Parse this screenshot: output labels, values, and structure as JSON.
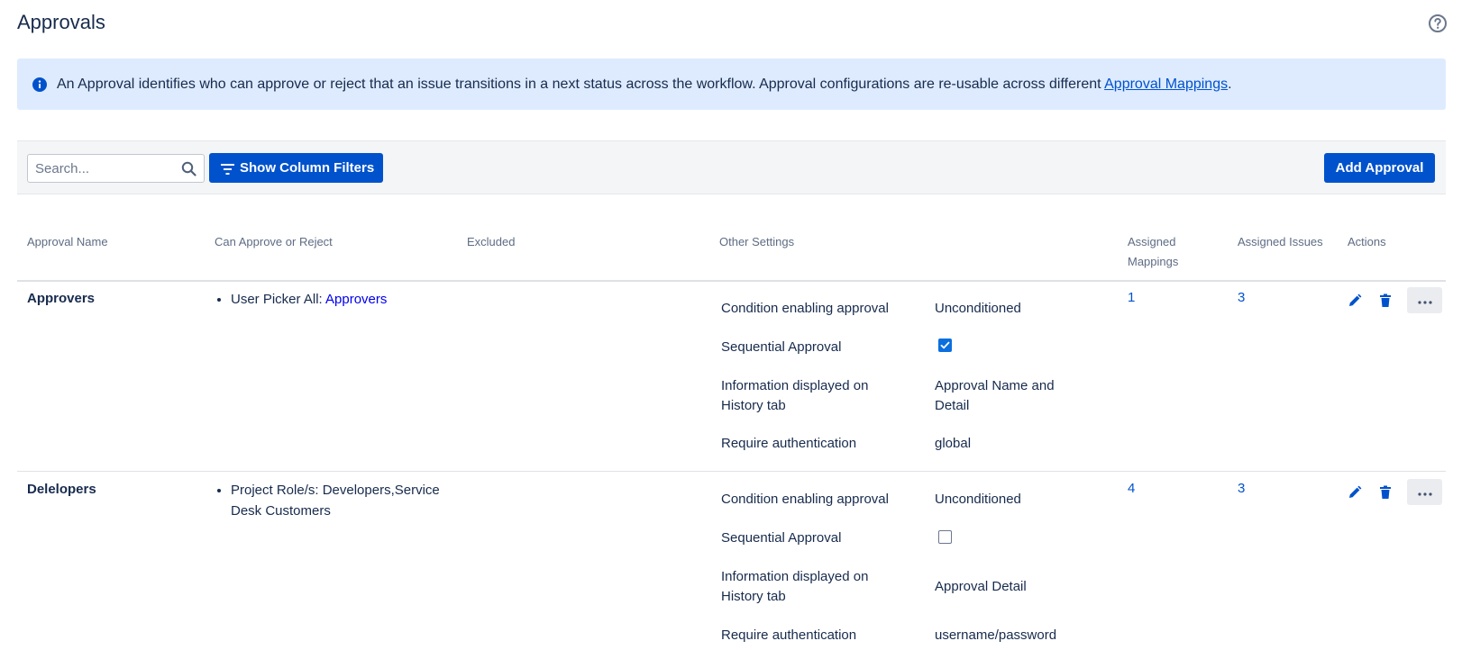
{
  "page": {
    "title": "Approvals"
  },
  "banner": {
    "text": "An Approval identifies who can approve or reject that an issue transitions in a next status across the workflow. Approval configurations are re-usable across different ",
    "link": "Approval Mappings",
    "suffix": "."
  },
  "toolbar": {
    "search_placeholder": "Search...",
    "filters_label": "Show Column Filters",
    "add_label": "Add Approval"
  },
  "columns": {
    "name": "Approval Name",
    "approve": "Can Approve or Reject",
    "excluded": "Excluded",
    "other": "Other Settings",
    "mappings_line1": "Assigned",
    "mappings_line2": "Mappings",
    "issues": "Assigned Issues",
    "actions": "Actions"
  },
  "rows": [
    {
      "name": "Approvers",
      "approver_prefix": "User Picker All: ",
      "approver_link": "Approvers",
      "settings": {
        "condition_label": "Condition enabling approval",
        "condition_value": "Unconditioned",
        "sequential_label": "Sequential Approval",
        "sequential_checked": true,
        "info_label_1": "Information displayed on",
        "info_label_2": "History tab",
        "info_value_1": "Approval Name and",
        "info_value_2": "Detail",
        "auth_label": "Require authentication",
        "auth_value": "global"
      },
      "mappings": "1",
      "issues": "3"
    },
    {
      "name": "Delelopers",
      "approver_line1": "Project Role/s: Developers,Service",
      "approver_line2": "Desk Customers",
      "settings": {
        "condition_label": "Condition enabling approval",
        "condition_value": "Unconditioned",
        "sequential_label": "Sequential Approval",
        "sequential_checked": false,
        "info_label_1": "Information displayed on",
        "info_label_2": "History tab",
        "info_value": "Approval Detail",
        "auth_label": "Require authentication",
        "auth_value": "username/password"
      },
      "mappings": "4",
      "issues": "3"
    }
  ],
  "colors": {
    "accent": "#0052cc",
    "banner_bg": "#deebff",
    "toolbar_bg": "#f4f5f7"
  },
  "icons": [
    "help-icon",
    "info-icon",
    "search-icon",
    "filter-icon",
    "edit-icon",
    "trash-icon",
    "more-icon"
  ]
}
